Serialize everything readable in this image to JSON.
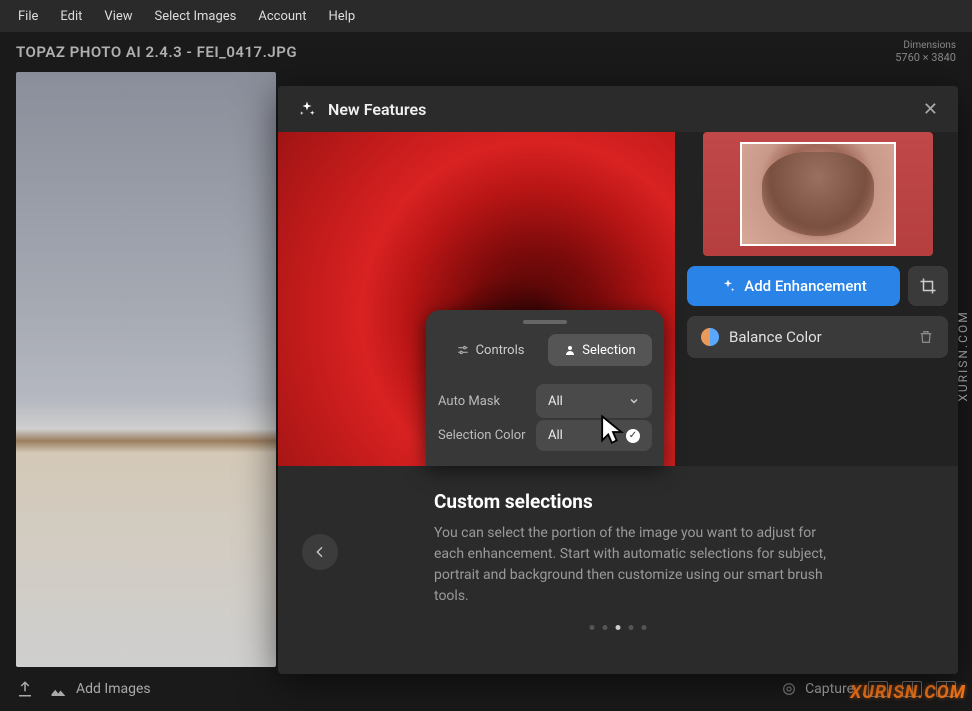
{
  "menubar": [
    "File",
    "Edit",
    "View",
    "Select Images",
    "Account",
    "Help"
  ],
  "titlebar": {
    "title": "TOPAZ PHOTO AI 2.4.3 - FEI_0417.JPG",
    "dim_label": "Dimensions",
    "dim_value": "5760 × 3840"
  },
  "footer": {
    "add_images": "Add Images",
    "capture": "Capture"
  },
  "modal": {
    "title": "New Features",
    "add_enhancement": "Add Enhancement",
    "balance_color": "Balance Color",
    "panel": {
      "controls": "Controls",
      "selection": "Selection",
      "auto_mask": "Auto Mask",
      "auto_mask_value": "All",
      "selection_color": "Selection Color",
      "dd_option": "All"
    },
    "desc": {
      "heading": "Custom selections",
      "body": "You can select the portion of the image you want to adjust for each enhancement. Start with automatic selections for subject, portrait and background then customize using our smart brush tools."
    },
    "active_dot": 2,
    "total_dots": 5
  },
  "watermark": "XURISN.COM",
  "side_watermark": "XURISN.COM"
}
